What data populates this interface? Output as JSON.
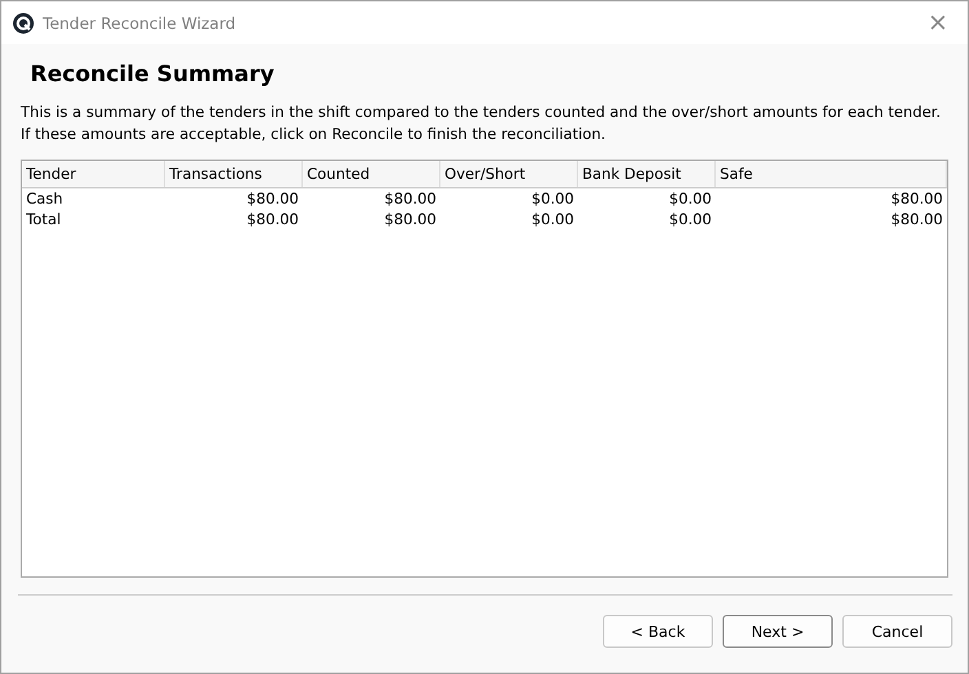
{
  "window": {
    "title": "Tender Reconcile Wizard",
    "close": "×"
  },
  "heading": "Reconcile Summary",
  "description": "This is a summary of the tenders in the shift compared to the tenders counted and the over/short amounts for each tender. If these amounts are acceptable, click on Reconcile to finish the reconciliation.",
  "table": {
    "columns": [
      "Tender",
      "Transactions",
      "Counted",
      "Over/Short",
      "Bank Deposit",
      "Safe"
    ],
    "rows": [
      [
        "Cash",
        "$80.00",
        "$80.00",
        "$0.00",
        "$0.00",
        "$80.00"
      ],
      [
        "Total",
        "$80.00",
        "$80.00",
        "$0.00",
        "$0.00",
        "$80.00"
      ]
    ]
  },
  "buttons": [
    {
      "label": "< Back",
      "focused": false
    },
    {
      "label": "Next >",
      "focused": true
    },
    {
      "label": "Cancel",
      "focused": false
    }
  ]
}
